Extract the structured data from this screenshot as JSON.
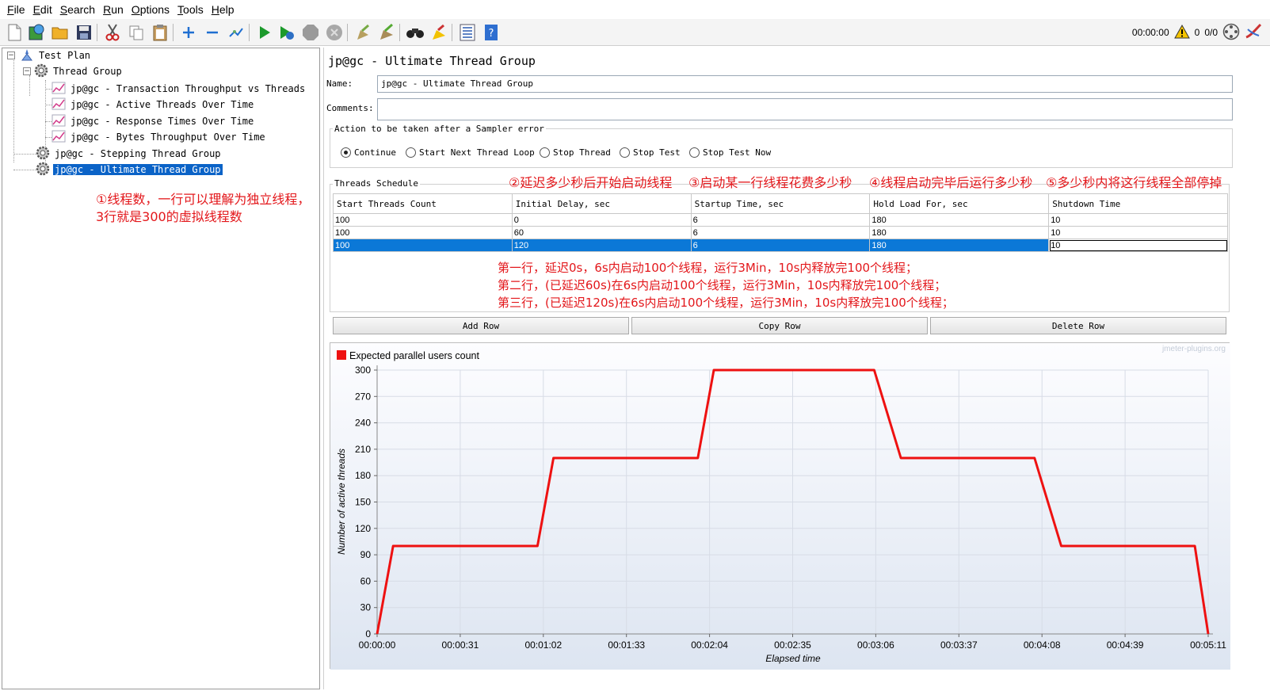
{
  "menu": [
    "File",
    "Edit",
    "Search",
    "Run",
    "Options",
    "Tools",
    "Help"
  ],
  "menu_mnemonics": [
    "F",
    "E",
    "S",
    "R",
    "O",
    "T",
    "H"
  ],
  "status": {
    "elapsed": "00:00:00",
    "warnings": "0",
    "threads": "0/0"
  },
  "tree": {
    "test_plan": "Test Plan",
    "thread_group": "Thread Group",
    "listeners": [
      "jp@gc - Transaction Throughput vs Threads",
      "jp@gc - Active Threads Over Time",
      "jp@gc - Response Times Over Time",
      "jp@gc - Bytes Throughput Over Time"
    ],
    "stepping": "jp@gc - Stepping Thread Group",
    "ultimate": "jp@gc - Ultimate Thread Group"
  },
  "annotations": {
    "threads_note_1": "①线程数，一行可以理解为独立线程，",
    "threads_note_2": "3行就是300的虚拟线程数",
    "col2": "②延迟多少秒后开始启动线程",
    "col3": "③启动某一行线程花费多少秒",
    "col4": "④线程启动完毕后运行多少秒",
    "col5": "⑤多少秒内将这行线程全部停掉",
    "row1": "第一行，延迟0s，6s内启动100个线程，运行3Min，10s内释放完100个线程；",
    "row2": "第二行，(已延迟60s)在6s内启动100个线程，运行3Min，10s内释放完100个线程；",
    "row3": "第三行，(已延迟120s)在6s内启动100个线程，运行3Min，10s内释放完100个线程；"
  },
  "panel": {
    "title": "jp@gc - Ultimate Thread Group",
    "name_label": "Name:",
    "name_value": "jp@gc - Ultimate Thread Group",
    "comments_label": "Comments:",
    "comments_value": "",
    "error_group_label": "Action to be taken after a Sampler error",
    "error_actions": [
      "Continue",
      "Start Next Thread Loop",
      "Stop Thread",
      "Stop Test",
      "Stop Test Now"
    ],
    "error_selected": "Continue",
    "schedule_label": "Threads Schedule",
    "columns": [
      "Start Threads Count",
      "Initial Delay, sec",
      "Startup Time, sec",
      "Hold Load For, sec",
      "Shutdown Time"
    ],
    "rows": [
      [
        "100",
        "0",
        "6",
        "180",
        "10"
      ],
      [
        "100",
        "60",
        "6",
        "180",
        "10"
      ],
      [
        "100",
        "120",
        "6",
        "180",
        "10"
      ]
    ],
    "buttons": {
      "add": "Add Row",
      "copy": "Copy Row",
      "delete": "Delete Row"
    }
  },
  "colors": {
    "line": "#ee1111",
    "selection": "#0b78d7",
    "annotation": "#e3171b"
  },
  "chart_data": {
    "type": "line",
    "legend": "Expected parallel users count",
    "watermark": "jmeter-plugins.org",
    "xlabel": "Elapsed time",
    "ylabel": "Number of active threads",
    "ylim": [
      0,
      300
    ],
    "yticks": [
      0,
      30,
      60,
      90,
      120,
      150,
      180,
      210,
      240,
      270,
      300
    ],
    "xlim_sec": [
      0,
      311
    ],
    "xticks": [
      "00:00:00",
      "00:00:31",
      "00:01:02",
      "00:01:33",
      "00:02:04",
      "00:02:35",
      "00:03:06",
      "00:03:37",
      "00:04:08",
      "00:04:39",
      "00:05:11"
    ],
    "x_sec": [
      0,
      6,
      60,
      66,
      120,
      126,
      186,
      196,
      246,
      256,
      306,
      311
    ],
    "y": [
      0,
      100,
      100,
      200,
      200,
      300,
      300,
      200,
      200,
      100,
      100,
      0
    ],
    "grid": true
  }
}
